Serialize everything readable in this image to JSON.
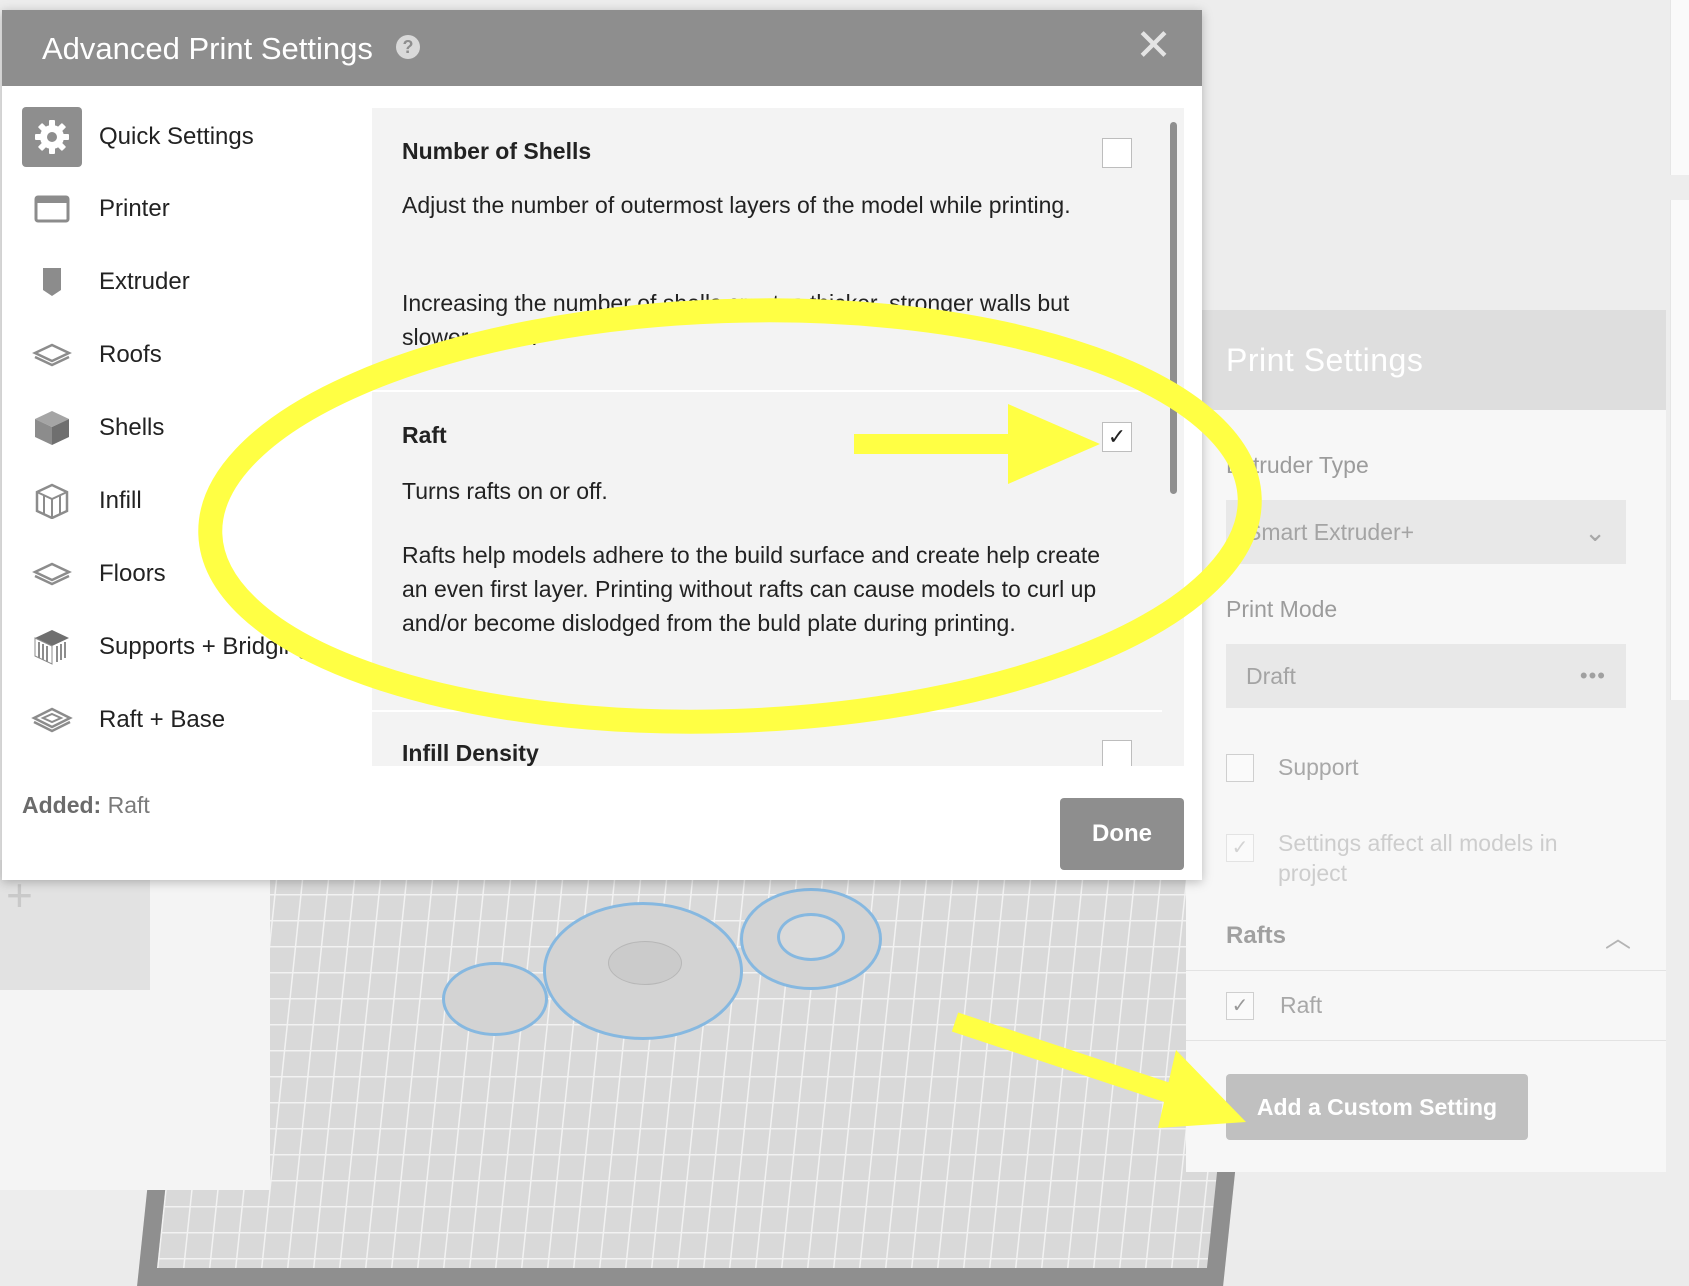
{
  "modal": {
    "title": "Advanced Print Settings",
    "help_icon": "?",
    "close_icon": "✕"
  },
  "nav": {
    "items": [
      {
        "label": "Quick Settings",
        "icon": "gear-icon"
      },
      {
        "label": "Printer",
        "icon": "printer-icon"
      },
      {
        "label": "Extruder",
        "icon": "extruder-icon"
      },
      {
        "label": "Roofs",
        "icon": "roofs-icon"
      },
      {
        "label": "Shells",
        "icon": "shells-icon"
      },
      {
        "label": "Infill",
        "icon": "infill-icon"
      },
      {
        "label": "Floors",
        "icon": "floors-icon"
      },
      {
        "label": "Supports + Bridging",
        "icon": "supports-icon"
      },
      {
        "label": "Raft + Base",
        "icon": "raft-base-icon"
      }
    ],
    "active": "Quick Settings"
  },
  "settings": [
    {
      "title": "Number of Shells",
      "checked": false,
      "desc1": "Adjust the number of outermost layers of the model while printing.",
      "desc2": "Increasing the number of shells creates thicker, stronger walls but slower prints."
    },
    {
      "title": "Raft",
      "checked": true,
      "desc1": "Turns rafts on or off.",
      "desc2": "Rafts help models adhere to the build surface and create help create an even first layer. Printing without rafts can cause models to curl up and/or become dislodged from the buld plate during printing."
    },
    {
      "title": "Infill Density",
      "checked": false
    }
  ],
  "added": {
    "label": "Added:",
    "value": "Raft"
  },
  "done_label": "Done",
  "print_settings": {
    "title": "Print Settings",
    "extruder_type_label": "Extruder Type",
    "extruder_type_value": "Smart Extruder+",
    "print_mode_label": "Print Mode",
    "print_mode_value": "Draft",
    "support_label": "Support",
    "support_checked": false,
    "affect_all_label": "Settings affect all models in project",
    "affect_all_checked": true,
    "rafts_section": "Rafts",
    "raft_label": "Raft",
    "raft_checked": true,
    "add_custom_label": "Add a Custom Setting"
  },
  "colors": {
    "header_gray": "#8e8e8e",
    "annotation_yellow": "#ffff44",
    "model_outline": "#86b8e0"
  }
}
